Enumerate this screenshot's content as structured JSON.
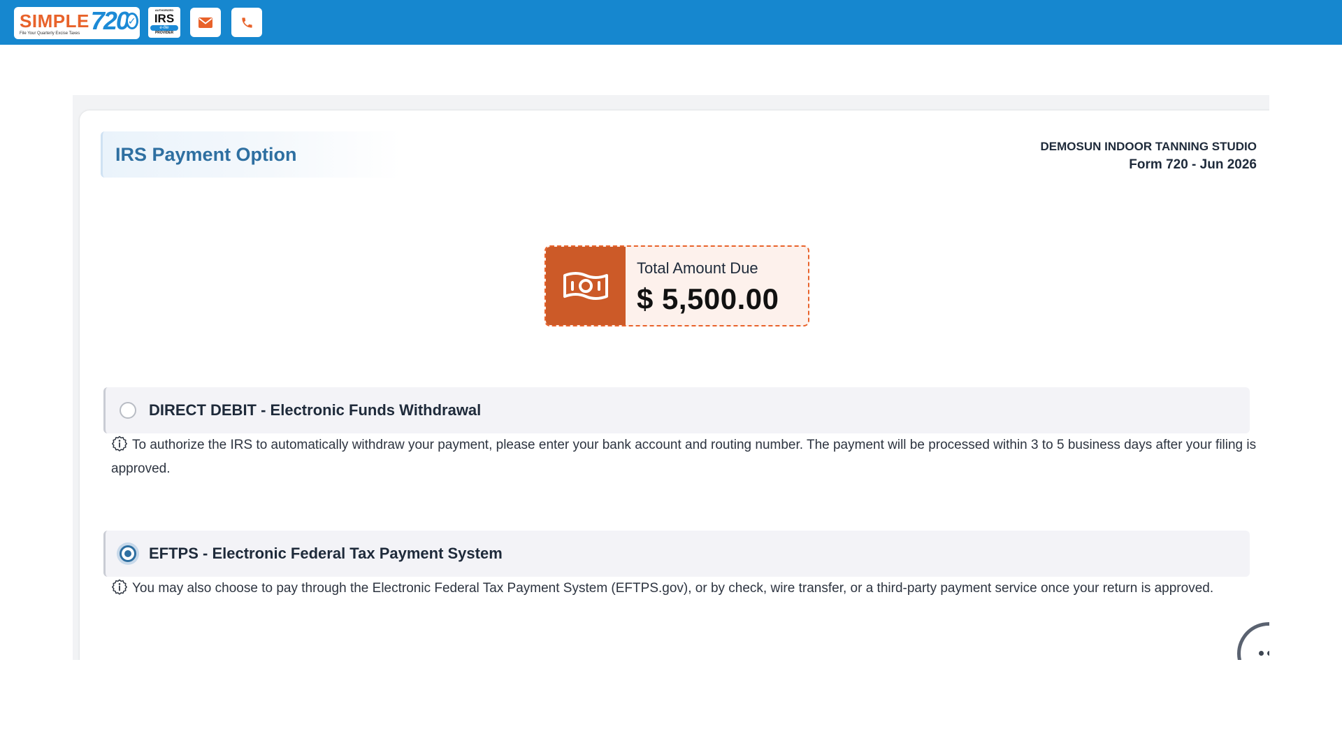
{
  "header": {
    "logo": {
      "word": "SIMPLE",
      "number": "720",
      "tagline": "File Your Quarterly Excise Taxes"
    },
    "irs_badge": {
      "top": "AUTHORIZED",
      "main": "IRS",
      "efile": "e-file",
      "bottom": "PROVIDER"
    },
    "brand_color": "#1687cf",
    "icons": [
      "envelope-icon",
      "phone-icon"
    ]
  },
  "page": {
    "title": "IRS Payment Option",
    "company_name": "DEMOSUN INDOOR TANNING STUDIO",
    "form_period": "Form 720 - Jun 2026"
  },
  "total_due": {
    "label": "Total Amount Due",
    "amount": "$ 5,500.00",
    "icon": "money-bill-icon",
    "accent": "#cc5a28"
  },
  "payment_options": [
    {
      "label": "DIRECT DEBIT - Electronic Funds Withdrawal",
      "selected": false,
      "note": "To authorize the IRS to automatically withdraw your payment, please enter your bank account and routing number. The payment will be processed within 3 to 5 business days after your filing is approved."
    },
    {
      "label": "EFTPS - Electronic Federal Tax Payment System",
      "selected": true,
      "note": "You may also choose to pay through the Electronic Federal Tax Payment System (EFTPS.gov), or by check, wire transfer, or a third-party payment service once your return is approved."
    }
  ]
}
